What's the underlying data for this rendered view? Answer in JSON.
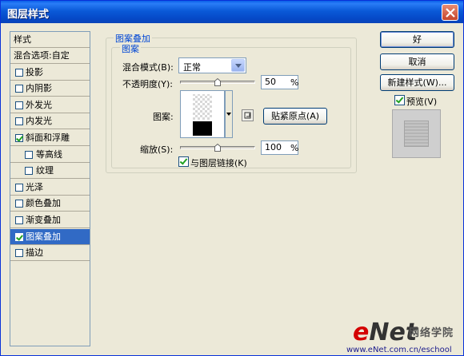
{
  "window": {
    "title": "图层样式"
  },
  "styles_panel": {
    "header": "样式",
    "items": [
      {
        "label": "混合选项:自定",
        "type": "header"
      },
      {
        "label": "投影",
        "checked": false
      },
      {
        "label": "内阴影",
        "checked": false
      },
      {
        "label": "外发光",
        "checked": false
      },
      {
        "label": "内发光",
        "checked": false
      },
      {
        "label": "斜面和浮雕",
        "checked": true
      },
      {
        "label": "等高线",
        "checked": false,
        "indent": true
      },
      {
        "label": "纹理",
        "checked": false,
        "indent": true
      },
      {
        "label": "光泽",
        "checked": false
      },
      {
        "label": "颜色叠加",
        "checked": false
      },
      {
        "label": "渐变叠加",
        "checked": false
      },
      {
        "label": "图案叠加",
        "checked": true,
        "selected": true
      },
      {
        "label": "描边",
        "checked": false
      }
    ]
  },
  "pattern_overlay": {
    "group_title": "图案叠加",
    "subgroup_title": "图案",
    "blend_mode_label": "混合模式(B):",
    "blend_mode_value": "正常",
    "opacity_label": "不透明度(Y):",
    "opacity_value": "50",
    "opacity_unit": "%",
    "opacity_level": 0.5,
    "pattern_label": "图案:",
    "snap_origin_button": "贴紧原点(A)",
    "scale_label": "缩放(S):",
    "scale_value": "100",
    "scale_unit": "%",
    "scale_level": 0.5,
    "link_layer_label": "与图层链接(K)",
    "link_layer_checked": true
  },
  "buttons": {
    "ok": "好",
    "cancel": "取消",
    "new_style": "新建样式(W)...",
    "preview_label": "预览(V)",
    "preview_checked": true
  },
  "watermark": {
    "logo_e": "e",
    "logo_net": "Net",
    "logo_cn": "网络学院",
    "url": "www.eNet.com.cn/eschool"
  }
}
